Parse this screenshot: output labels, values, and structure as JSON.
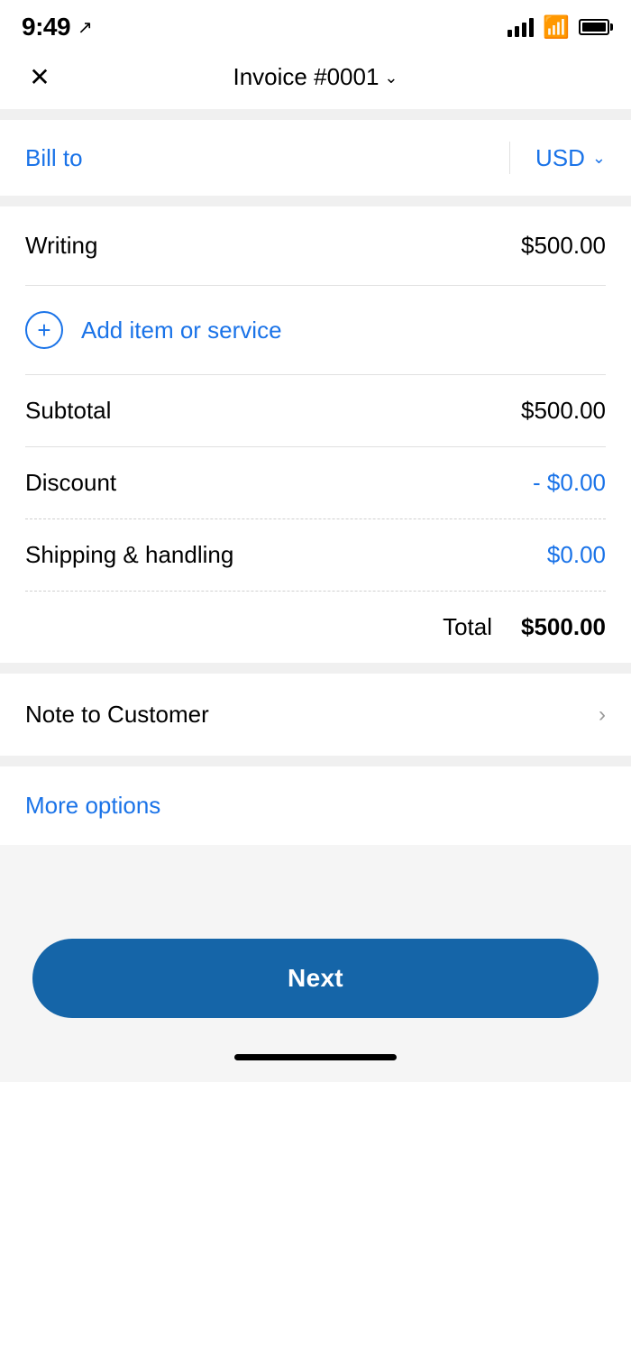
{
  "statusBar": {
    "time": "9:49",
    "locationArrow": "↗"
  },
  "header": {
    "closeLabel": "×",
    "titlePrefix": "Invoice ",
    "titleNumber": "#0001",
    "titleChevron": "⌄"
  },
  "billTo": {
    "label": "Bill to",
    "currency": "USD",
    "currencyChevron": "⌄"
  },
  "items": [
    {
      "name": "Writing",
      "price": "$500.00"
    }
  ],
  "addItem": {
    "label": "Add item or service"
  },
  "subtotal": {
    "label": "Subtotal",
    "value": "$500.00"
  },
  "discount": {
    "label": "Discount",
    "value": "- $0.00"
  },
  "shipping": {
    "label": "Shipping & handling",
    "value": "$0.00"
  },
  "total": {
    "label": "Total",
    "value": "$500.00"
  },
  "noteToCustomer": {
    "label": "Note to Customer"
  },
  "moreOptions": {
    "label": "More options"
  },
  "nextButton": {
    "label": "Next"
  },
  "colors": {
    "blue": "#1a73e8",
    "darkBlue": "#1565a8",
    "black": "#000000",
    "gray": "#f0f0f0"
  }
}
